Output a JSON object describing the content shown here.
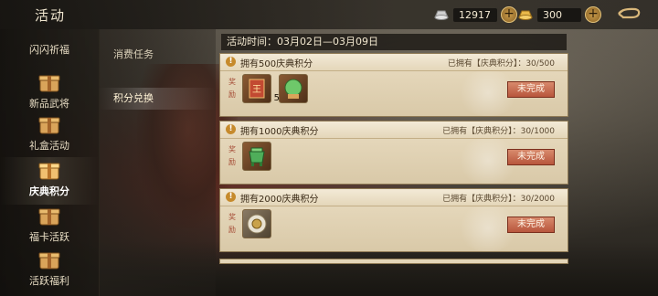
{
  "header": {
    "title": "活动",
    "resource_copper": "12917",
    "resource_gold": "300"
  },
  "sidebar": {
    "items": [
      {
        "label": "闪闪祈福"
      },
      {
        "label": "新品武将"
      },
      {
        "label": "礼盒活动"
      },
      {
        "label": "庆典积分"
      },
      {
        "label": "福卡活跃"
      },
      {
        "label": "活跃福利"
      }
    ],
    "active_index": 3
  },
  "submenu": {
    "items": [
      {
        "label": "消费任务"
      },
      {
        "label": "积分兑换"
      }
    ],
    "active_index": 1
  },
  "main": {
    "time_text": "活动时间：03月02日—03月09日",
    "reward_tag": "奖励",
    "tasks": [
      {
        "name": "拥有500庆典积分",
        "progress": "已拥有【庆典积分】：30/500",
        "status": "未完成",
        "rewards": [
          {
            "icon": "token-icon",
            "count": "5"
          },
          {
            "icon": "jade-orb-icon",
            "count": ""
          }
        ]
      },
      {
        "name": "拥有1000庆典积分",
        "progress": "已拥有【庆典积分】：30/1000",
        "status": "未完成",
        "rewards": [
          {
            "icon": "jade-cauldron-icon",
            "count": ""
          }
        ]
      },
      {
        "name": "拥有2000庆典积分",
        "progress": "已拥有【庆典积分】：30/2000",
        "status": "未完成",
        "rewards": [
          {
            "icon": "silver-coin-icon",
            "count": ""
          }
        ]
      }
    ]
  },
  "colors": {
    "panel": "#e9dcc1",
    "status_button": "#c0603e",
    "accent_gold": "#c89a4a"
  }
}
